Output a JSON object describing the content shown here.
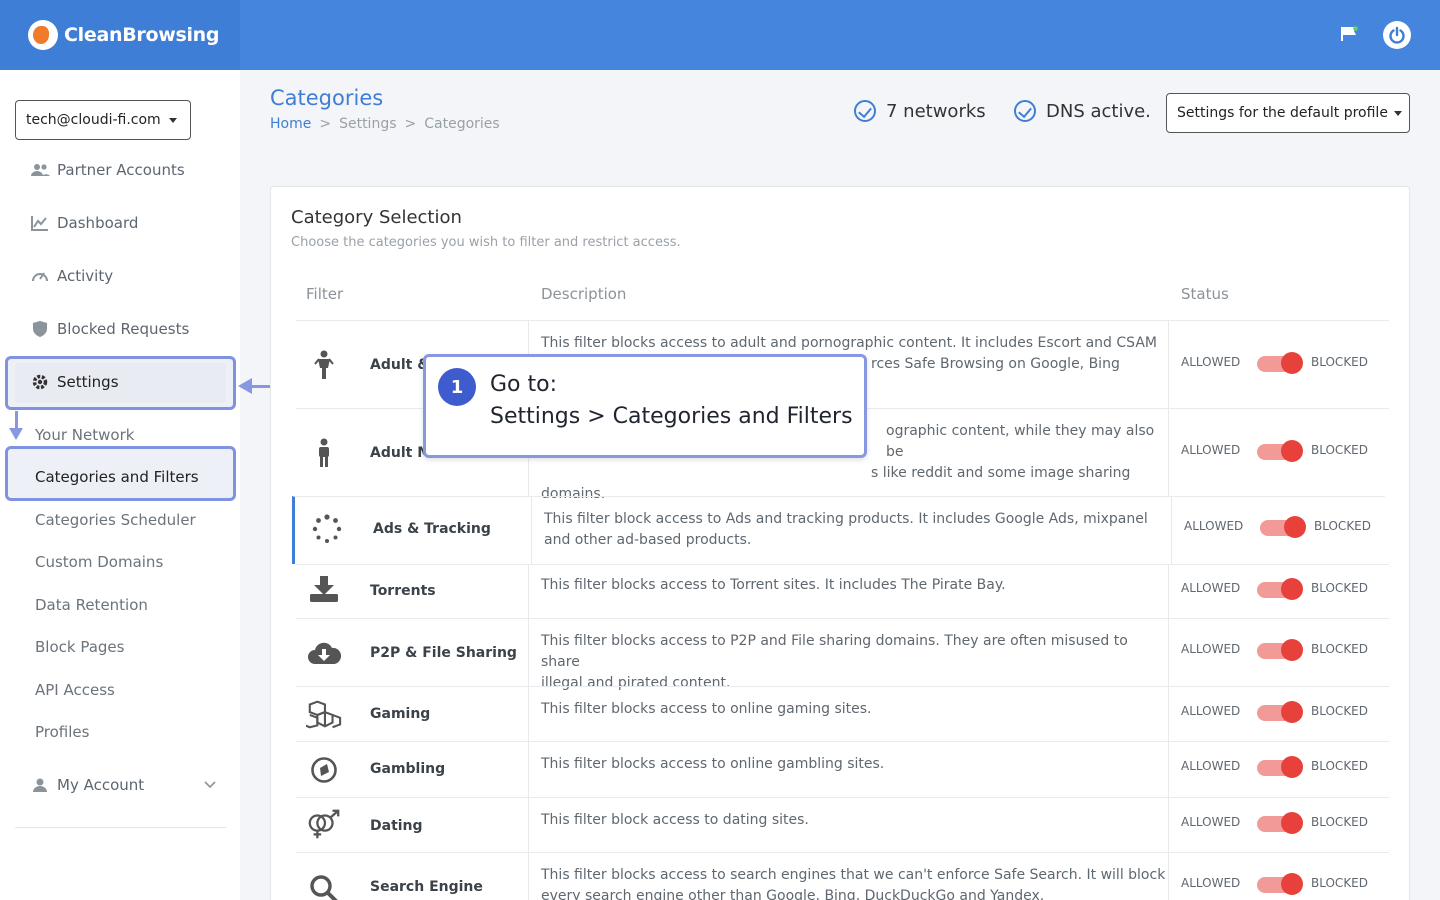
{
  "app": {
    "brand": "CleanBrowsing"
  },
  "sidebar": {
    "account": "tech@cloudi-fi.com",
    "items": [
      {
        "label": "Partner Accounts",
        "icon": "users-icon"
      },
      {
        "label": "Dashboard",
        "icon": "chart-icon"
      },
      {
        "label": "Activity",
        "icon": "gauge-icon"
      },
      {
        "label": "Blocked Requests",
        "icon": "shield-icon"
      },
      {
        "label": "Settings",
        "icon": "gear-icon"
      }
    ],
    "sub_items": [
      "Your Network",
      "Categories and Filters",
      "Categories Scheduler",
      "Custom Domains",
      "Data Retention",
      "Block Pages",
      "API Access",
      "Profiles"
    ],
    "my_account": "My Account"
  },
  "page": {
    "title": "Categories",
    "breadcrumb": [
      "Home",
      "Settings",
      "Categories"
    ],
    "networks": "7 networks",
    "dns": "DNS active.",
    "profile_select": "Settings for the default profile"
  },
  "card": {
    "title": "Category Selection",
    "subtitle": "Choose the categories you wish to filter and restrict access.",
    "headers": {
      "filter": "Filter",
      "description": "Description",
      "status": "Status"
    },
    "allowed_label": "ALLOWED",
    "blocked_label": "BLOCKED",
    "rows": [
      {
        "name": "Adult &",
        "desc": "This filter blocks access to adult and pornographic content. It includes Escort and CSAM",
        "desc2": "rces Safe Browsing on Google, Bing"
      },
      {
        "name": "Adult Mi",
        "desc": "ographic content, while they may also be",
        "desc2": "s like reddit and some image sharing",
        "desc3": "domains."
      },
      {
        "name": "Ads & Tracking",
        "desc": "This filter block access to Ads and tracking products. It includes Google Ads, mixpanel",
        "desc2": "and other ad-based products."
      },
      {
        "name": "Torrents",
        "desc": "This filter blocks access to Torrent sites. It includes The Pirate Bay."
      },
      {
        "name": "P2P & File Sharing",
        "desc": "This filter blocks access to P2P and File sharing domains. They are often misused to share",
        "desc2": "illegal and pirated content."
      },
      {
        "name": "Gaming",
        "desc": "This filter blocks access to online gaming sites."
      },
      {
        "name": "Gambling",
        "desc": "This filter blocks access to online gambling sites."
      },
      {
        "name": "Dating",
        "desc": "This filter block access to dating sites."
      },
      {
        "name": "Search Engine",
        "desc": "This filter blocks access to search engines that we can't enforce Safe Search. It will block",
        "desc2": "every search engine other than Google, Bing, DuckDuckGo and Yandex."
      }
    ]
  },
  "callout": {
    "number": "1",
    "line1": "Go to:",
    "line2": "Settings > Categories and Filters"
  },
  "colors": {
    "header": "#4585de",
    "accent": "#3f7ed6",
    "toggle_on": "#e8413c",
    "callout_border": "#8797e2"
  }
}
